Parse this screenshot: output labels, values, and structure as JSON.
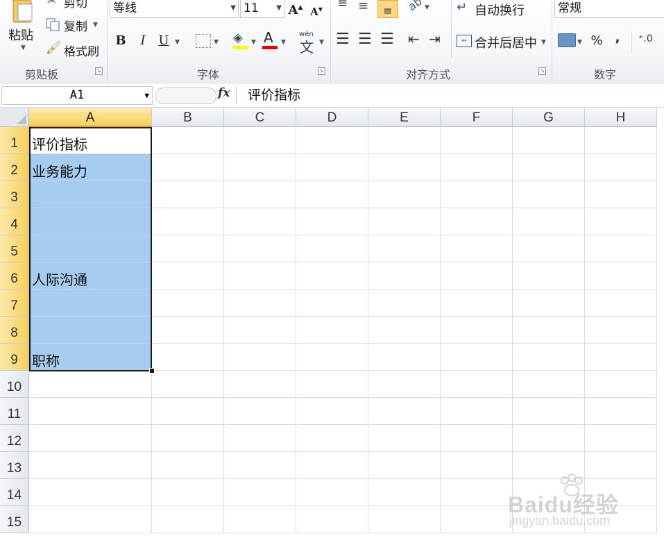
{
  "ribbon": {
    "clipboard": {
      "paste_label": "粘贴",
      "cut_label": "剪切",
      "copy_label": "复制",
      "format_painter_label": "格式刷",
      "group_label": "剪贴板"
    },
    "font": {
      "font_name": "等线",
      "font_size": "11",
      "group_label": "字体",
      "bold": "B",
      "italic": "I",
      "underline": "U",
      "font_color_letter": "A",
      "wen_label": "wén",
      "wen_char": "文"
    },
    "alignment": {
      "wrap_text_label": "自动换行",
      "merge_center_label": "合并后居中",
      "group_label": "对齐方式"
    },
    "number": {
      "format_value": "常规",
      "percent": "%",
      "comma": ",",
      "group_label": "数字"
    }
  },
  "formula_bar": {
    "name_box": "A1",
    "fx_label": "fx",
    "content": "评价指标"
  },
  "grid": {
    "columns": [
      "A",
      "B",
      "C",
      "D",
      "E",
      "F",
      "G",
      "H"
    ],
    "rows": [
      "1",
      "2",
      "3",
      "4",
      "5",
      "6",
      "7",
      "8",
      "9",
      "10",
      "11",
      "12",
      "13",
      "14",
      "15"
    ],
    "cells": {
      "A1": "评价指标",
      "A2": "业务能力",
      "A6": "人际沟通",
      "A9": "职称"
    }
  },
  "watermark": {
    "brand": "Baidu经验",
    "url": "jingyan.baidu.com"
  },
  "colors": {
    "selection_fill": "#a6cdef",
    "header_selected": "#f7cf5c",
    "font_color_bar": "#e00000",
    "highlight_bar": "#ffff00"
  }
}
